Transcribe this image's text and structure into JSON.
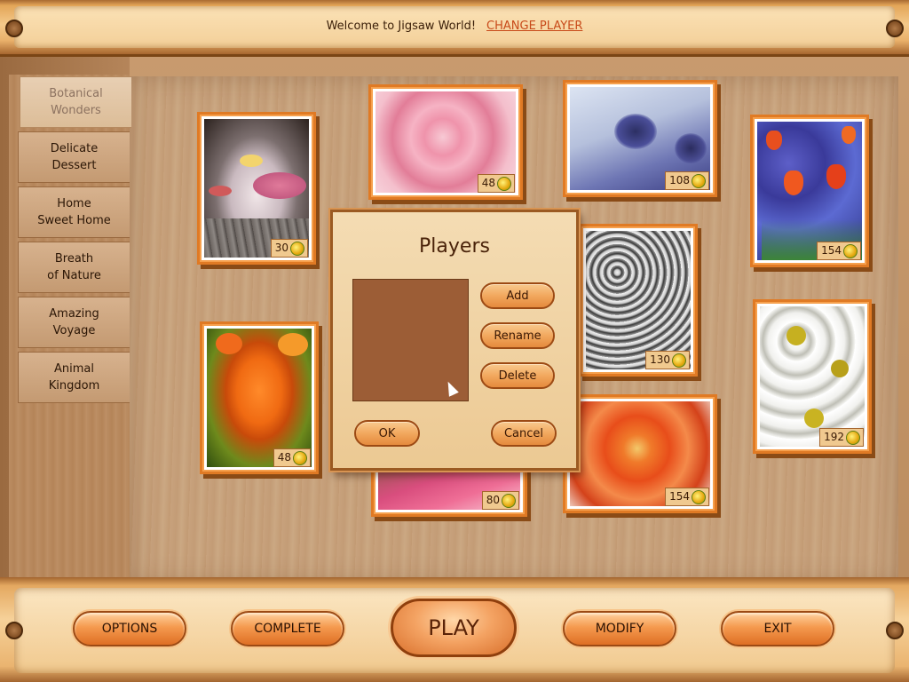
{
  "header": {
    "welcome": "Welcome to Jigsaw World!",
    "change_player": "CHANGE PLAYER"
  },
  "sidebar": {
    "items": [
      {
        "label": "Botanical\nWonders",
        "active": true
      },
      {
        "label": "Delicate\nDessert",
        "active": false
      },
      {
        "label": "Home\nSweet Home",
        "active": false
      },
      {
        "label": "Breath\nof Nature",
        "active": false
      },
      {
        "label": "Amazing\nVoyage",
        "active": false
      },
      {
        "label": "Animal\nKingdom",
        "active": false
      }
    ]
  },
  "puzzles": [
    {
      "subject": "floating candles",
      "pieces": "30"
    },
    {
      "subject": "pink rose",
      "pieces": "48"
    },
    {
      "subject": "blue thistle",
      "pieces": "108"
    },
    {
      "subject": "tulips",
      "pieces": "154"
    },
    {
      "subject": "orange rose",
      "pieces": "48"
    },
    {
      "subject": "white blossoms",
      "pieces": "130"
    },
    {
      "subject": "daisies",
      "pieces": "192"
    },
    {
      "subject": "pink petal",
      "pieces": "80"
    },
    {
      "subject": "red dahlia",
      "pieces": "154"
    }
  ],
  "dialog": {
    "title": "Players",
    "add": "Add",
    "rename": "Rename",
    "delete": "Delete",
    "ok": "OK",
    "cancel": "Cancel"
  },
  "bottom": {
    "options": "OPTIONS",
    "complete": "COMPLETE",
    "play": "PLAY",
    "modify": "MODIFY",
    "exit": "EXIT"
  },
  "colors": {
    "accent": "#e07a24",
    "link": "#c84a1a"
  }
}
